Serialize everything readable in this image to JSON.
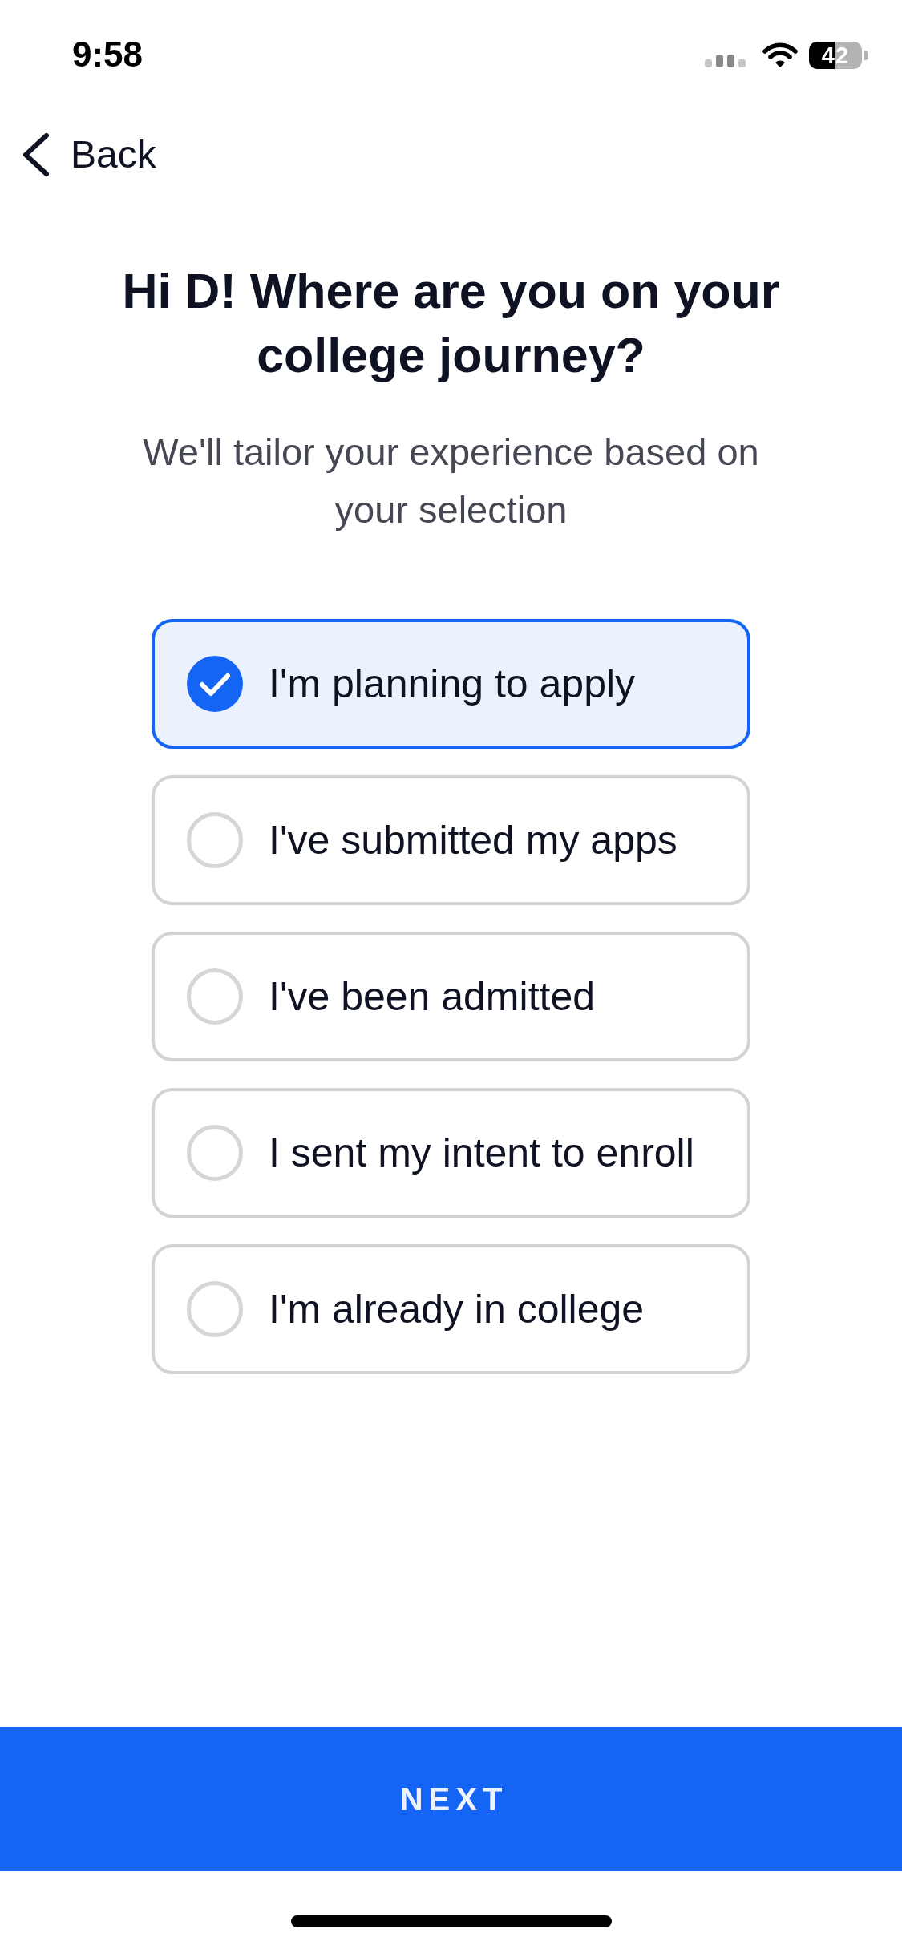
{
  "status_bar": {
    "time": "9:58",
    "battery": "42"
  },
  "nav": {
    "back": "Back"
  },
  "heading": {
    "title": "Hi D! Where are you on your college journey?",
    "subtitle": "We'll tailor your experience based on your selection"
  },
  "options": [
    {
      "label": "I'm planning to apply",
      "selected": true
    },
    {
      "label": "I've submitted my apps",
      "selected": false
    },
    {
      "label": "I've been admitted",
      "selected": false
    },
    {
      "label": "I sent my intent to enroll",
      "selected": false
    },
    {
      "label": "I'm already in college",
      "selected": false
    }
  ],
  "next_button": {
    "label": "NEXT"
  }
}
